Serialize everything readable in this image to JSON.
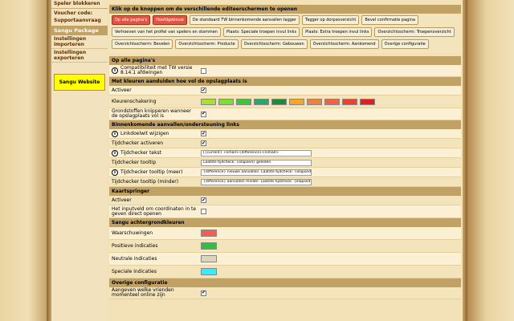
{
  "sidebar": {
    "top_links": [
      "Speler blokkeren",
      "Voucher code:",
      "Supportaanvraag"
    ],
    "package_header": "Sangu Package",
    "items": [
      "Instellingen importeren",
      "Instellingen exporteren"
    ],
    "website_label": "Sangu Website"
  },
  "editors": {
    "title": "Klik op de knoppen om de verschillende editeerschermen te openen",
    "buttons": [
      {
        "label": "Op alle pagina's",
        "style": "red"
      },
      {
        "label": "Hoofdgebouw",
        "style": "red"
      },
      {
        "label": "De standaard TW binnenkomende aanvallen tagger",
        "style": "normal"
      },
      {
        "label": "Tagger op dorpsoverzicht",
        "style": "normal"
      },
      {
        "label": "Bevel confirmatie pagina",
        "style": "normal"
      },
      {
        "label": "Verhoeven van het profiel van spelers en stammen",
        "style": "normal"
      },
      {
        "label": "Plaats: Speciale troepen invul links",
        "style": "normal"
      },
      {
        "label": "Plaats: Extra troepen invul links",
        "style": "normal"
      },
      {
        "label": "Overzichtsscherm: Troepenoverzicht",
        "style": "normal"
      },
      {
        "label": "Overzichtsscherm: Bevelen",
        "style": "normal"
      },
      {
        "label": "Overzichtsscherm: Producte",
        "style": "normal"
      },
      {
        "label": "Overzichtsscherm: Gebouwen",
        "style": "normal"
      },
      {
        "label": "Overzichtsscherm: Aankomend",
        "style": "normal"
      },
      {
        "label": "Overige configuratie",
        "style": "normal"
      }
    ]
  },
  "settings": {
    "title": "Op alle pagina's",
    "compat": {
      "label": "Compatibiliteit met TW versie 8.14.1 afdwingen",
      "checked": false
    },
    "storage_section": "Met kleuren aanduiden hoe vol de opslagplaats is",
    "activate": {
      "label": "Activeer",
      "checked": true
    },
    "color_label": "Kleurenschakering",
    "gradient": [
      "#a6e22e",
      "#7be02b",
      "#3cc43c",
      "#2aa86a",
      "#1f8a3a",
      "#f5a623",
      "#f08040",
      "#f0604a",
      "#ec4030",
      "#e02020"
    ],
    "blink": {
      "label": "Grondstoffen knipperen wanneer de opslagplaats vol is",
      "checked": true
    },
    "incoming_section": "Binnenkomende aanvallen/ondersteuning links",
    "linkcolor": {
      "label": "Linkdoelwit wijzigen",
      "checked": true
    },
    "timecheck": {
      "label": "Tijdchecker activeren",
      "checked": true
    },
    "timecheck_text": {
      "label": "Tijdchecker tekst",
      "value": "[{current} <small>{difference}</small>"
    },
    "timecheck_tooltip": {
      "label": "Tijdchecker tooltip",
      "value": "Laatste tijdcheck: {elapsed} geleden"
    },
    "timecheck_more": {
      "label": "Tijdchecker tooltip (meer)",
      "value": "{difference} nieuwe aanvallen. Laatste tijdcheck: {elapsed}"
    },
    "timecheck_less": {
      "label": "Tijdchecker tooltip (minder)",
      "value": "{difference} aanvallen minder. Laatste tijdcheck: {elapsed}"
    },
    "mapjump_section": "Kaartspringer",
    "mapjump_activate": {
      "label": "Activeer",
      "checked": true
    },
    "mapjump_input": {
      "label": "Het inputveld om coordinaten in te geven direct openen",
      "checked": false
    },
    "bg_section": "Sangu achtergrondkleuren",
    "bg_colors": [
      {
        "label": "Waarschuwingen",
        "color": "#f06050"
      },
      {
        "label": "Positieve indicaties",
        "color": "#30c040"
      },
      {
        "label": "Neutrale indicaties",
        "color": "#ddd5b8"
      },
      {
        "label": "Speciale indicaties",
        "color": "#30f0ff"
      }
    ],
    "other_section": "Overige configuratie",
    "friends": {
      "label": "Aangeven welke vrienden momenteel online zijn",
      "checked": true
    }
  }
}
